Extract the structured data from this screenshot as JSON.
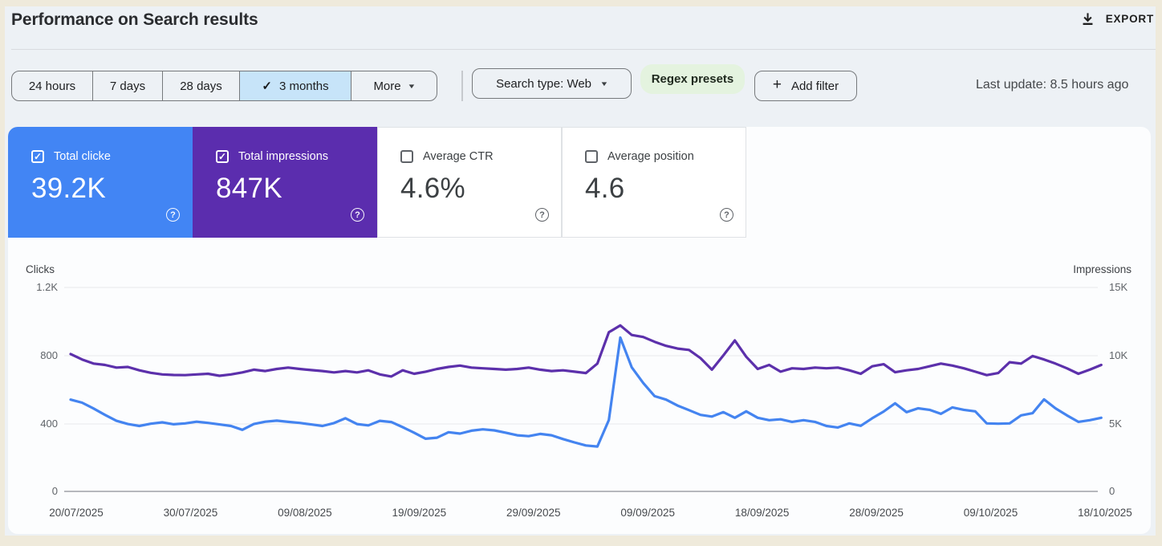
{
  "header": {
    "title": "Performance on Search results",
    "export_label": "EXPORT"
  },
  "filters": {
    "date_ranges": [
      {
        "label": "24 hours",
        "selected": false
      },
      {
        "label": "7 days",
        "selected": false
      },
      {
        "label": "28 days",
        "selected": false
      },
      {
        "label": "3 months",
        "selected": true
      },
      {
        "label": "More",
        "selected": false,
        "dropdown": true
      }
    ],
    "search_type_label": "Search type: Web",
    "regex_presets_label": "Regex presets",
    "add_filter_label": "Add filter",
    "last_update": "Last update: 8.5 hours ago"
  },
  "metric_cards": [
    {
      "label": "Total clicke",
      "value": "39.2K",
      "checked": true,
      "bg": "#4285f4",
      "fg": "#ffffff"
    },
    {
      "label": "Total impressions",
      "value": "847K",
      "checked": true,
      "bg": "#5b2dae",
      "fg": "#ffffff"
    },
    {
      "label": "Average CTR",
      "value": "4.6%",
      "checked": false,
      "bg": "#ffffff",
      "fg": "#3c4043"
    },
    {
      "label": "Average position",
      "value": "4.6",
      "checked": false,
      "bg": "#ffffff",
      "fg": "#3c4043"
    }
  ],
  "chart_data": {
    "type": "line",
    "left_axis": {
      "label": "Clicks",
      "ticks": [
        "1.2K",
        "800",
        "400",
        "0"
      ],
      "range": [
        0,
        1200
      ]
    },
    "right_axis": {
      "label": "Impressions",
      "ticks": [
        "15K",
        "10K",
        "5K",
        "0"
      ],
      "range": [
        0,
        15000
      ]
    },
    "x_ticks": [
      "20/07/2025",
      "30/07/2025",
      "09/08/2025",
      "19/09/2025",
      "29/09/2025",
      "09/09/2025",
      "18/09/2025",
      "28/09/2025",
      "09/10/2025",
      "18/10/2025"
    ],
    "grid": true,
    "legend_position": "none",
    "series": [
      {
        "name": "Total clicks",
        "axis": "left",
        "color": "#4484f0",
        "unit": "clicks",
        "points": [
          [
            0,
            540
          ],
          [
            1,
            522
          ],
          [
            2,
            488
          ],
          [
            3,
            450
          ],
          [
            4,
            415
          ],
          [
            5,
            396
          ],
          [
            6,
            385
          ],
          [
            7,
            398
          ],
          [
            8,
            406
          ],
          [
            9,
            395
          ],
          [
            10,
            400
          ],
          [
            11,
            410
          ],
          [
            12,
            403
          ],
          [
            13,
            394
          ],
          [
            14,
            385
          ],
          [
            15,
            362
          ],
          [
            16,
            396
          ],
          [
            17,
            410
          ],
          [
            18,
            416
          ],
          [
            19,
            409
          ],
          [
            20,
            403
          ],
          [
            21,
            394
          ],
          [
            22,
            385
          ],
          [
            23,
            402
          ],
          [
            24,
            430
          ],
          [
            25,
            396
          ],
          [
            26,
            388
          ],
          [
            27,
            415
          ],
          [
            28,
            408
          ],
          [
            29,
            378
          ],
          [
            30,
            345
          ],
          [
            31,
            310
          ],
          [
            32,
            316
          ],
          [
            33,
            348
          ],
          [
            34,
            340
          ],
          [
            35,
            357
          ],
          [
            36,
            365
          ],
          [
            37,
            359
          ],
          [
            38,
            345
          ],
          [
            39,
            330
          ],
          [
            40,
            325
          ],
          [
            41,
            338
          ],
          [
            42,
            330
          ],
          [
            43,
            308
          ],
          [
            44,
            288
          ],
          [
            45,
            270
          ],
          [
            46,
            264
          ],
          [
            47,
            420
          ],
          [
            48,
            905
          ],
          [
            49,
            730
          ],
          [
            50,
            638
          ],
          [
            51,
            560
          ],
          [
            52,
            540
          ],
          [
            53,
            505
          ],
          [
            54,
            478
          ],
          [
            55,
            450
          ],
          [
            56,
            440
          ],
          [
            57,
            466
          ],
          [
            58,
            433
          ],
          [
            59,
            471
          ],
          [
            60,
            433
          ],
          [
            61,
            419
          ],
          [
            62,
            424
          ],
          [
            63,
            409
          ],
          [
            64,
            419
          ],
          [
            65,
            409
          ],
          [
            66,
            385
          ],
          [
            67,
            376
          ],
          [
            68,
            400
          ],
          [
            69,
            386
          ],
          [
            70,
            430
          ],
          [
            71,
            470
          ],
          [
            72,
            518
          ],
          [
            73,
            466
          ],
          [
            74,
            489
          ],
          [
            75,
            480
          ],
          [
            76,
            456
          ],
          [
            77,
            494
          ],
          [
            78,
            480
          ],
          [
            79,
            471
          ],
          [
            80,
            400
          ],
          [
            81,
            398
          ],
          [
            82,
            400
          ],
          [
            83,
            447
          ],
          [
            84,
            460
          ],
          [
            85,
            541
          ],
          [
            86,
            489
          ],
          [
            87,
            447
          ],
          [
            88,
            409
          ],
          [
            89,
            419
          ],
          [
            90,
            433
          ]
        ]
      },
      {
        "name": "Total impressions",
        "axis": "right",
        "color": "#5c30ab",
        "unit": "thousands",
        "points": [
          [
            0,
            10.1
          ],
          [
            1,
            9.7
          ],
          [
            2,
            9.4
          ],
          [
            3,
            9.3
          ],
          [
            4,
            9.1
          ],
          [
            5,
            9.15
          ],
          [
            6,
            8.9
          ],
          [
            7,
            8.72
          ],
          [
            8,
            8.6
          ],
          [
            9,
            8.56
          ],
          [
            10,
            8.55
          ],
          [
            11,
            8.6
          ],
          [
            12,
            8.65
          ],
          [
            13,
            8.5
          ],
          [
            14,
            8.6
          ],
          [
            15,
            8.75
          ],
          [
            16,
            8.95
          ],
          [
            17,
            8.85
          ],
          [
            18,
            9.0
          ],
          [
            19,
            9.1
          ],
          [
            20,
            9.0
          ],
          [
            21,
            8.92
          ],
          [
            22,
            8.85
          ],
          [
            23,
            8.75
          ],
          [
            24,
            8.85
          ],
          [
            25,
            8.75
          ],
          [
            26,
            8.9
          ],
          [
            27,
            8.6
          ],
          [
            28,
            8.45
          ],
          [
            29,
            8.9
          ],
          [
            30,
            8.65
          ],
          [
            31,
            8.8
          ],
          [
            32,
            9.0
          ],
          [
            33,
            9.15
          ],
          [
            34,
            9.25
          ],
          [
            35,
            9.1
          ],
          [
            36,
            9.05
          ],
          [
            37,
            9.0
          ],
          [
            38,
            8.95
          ],
          [
            39,
            9.0
          ],
          [
            40,
            9.1
          ],
          [
            41,
            8.95
          ],
          [
            42,
            8.85
          ],
          [
            43,
            8.9
          ],
          [
            44,
            8.8
          ],
          [
            45,
            8.7
          ],
          [
            46,
            9.4
          ],
          [
            47,
            11.7
          ],
          [
            48,
            12.2
          ],
          [
            49,
            11.5
          ],
          [
            50,
            11.35
          ],
          [
            51,
            11.0
          ],
          [
            52,
            10.7
          ],
          [
            53,
            10.5
          ],
          [
            54,
            10.4
          ],
          [
            55,
            9.8
          ],
          [
            56,
            8.95
          ],
          [
            57,
            10.0
          ],
          [
            58,
            11.1
          ],
          [
            59,
            9.9
          ],
          [
            60,
            9.0
          ],
          [
            61,
            9.3
          ],
          [
            62,
            8.8
          ],
          [
            63,
            9.05
          ],
          [
            64,
            9.0
          ],
          [
            65,
            9.1
          ],
          [
            66,
            9.05
          ],
          [
            67,
            9.1
          ],
          [
            68,
            8.9
          ],
          [
            69,
            8.65
          ],
          [
            70,
            9.2
          ],
          [
            71,
            9.35
          ],
          [
            72,
            8.76
          ],
          [
            73,
            8.9
          ],
          [
            74,
            9.0
          ],
          [
            75,
            9.2
          ],
          [
            76,
            9.4
          ],
          [
            77,
            9.25
          ],
          [
            78,
            9.05
          ],
          [
            79,
            8.8
          ],
          [
            80,
            8.55
          ],
          [
            81,
            8.7
          ],
          [
            82,
            9.5
          ],
          [
            83,
            9.4
          ],
          [
            84,
            9.95
          ],
          [
            85,
            9.7
          ],
          [
            86,
            9.4
          ],
          [
            87,
            9.05
          ],
          [
            88,
            8.65
          ],
          [
            89,
            8.95
          ],
          [
            90,
            9.3
          ]
        ]
      }
    ]
  }
}
